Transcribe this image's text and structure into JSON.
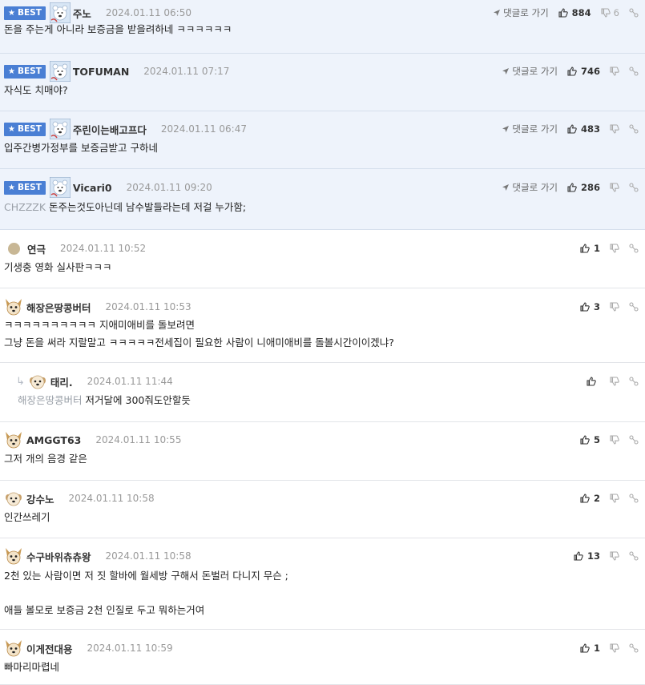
{
  "comments": [
    {
      "kind": "best",
      "badge": "BEST",
      "avatar": "polar-bear",
      "nick": "주노",
      "date": "2024.01.11 06:50",
      "reply_label": "댓글로 가기",
      "likes": "884",
      "dislikes": "6",
      "text": "돈을 주는게 아니라 보증금을 받을려하네 ㅋㅋㅋㅋㅋㅋ"
    },
    {
      "kind": "best",
      "badge": "BEST",
      "avatar": "polar-bear",
      "nick": "TOFUMAN",
      "date": "2024.01.11 07:17",
      "reply_label": "댓글로 가기",
      "likes": "746",
      "text": "자식도 치매야?"
    },
    {
      "kind": "best",
      "badge": "BEST",
      "avatar": "polar-bear",
      "nick": "주린이는배고프다",
      "date": "2024.01.11 06:47",
      "reply_label": "댓글로 가기",
      "likes": "483",
      "text": "입주간병가정부를 보증금받고 구하네"
    },
    {
      "kind": "best",
      "badge": "BEST",
      "avatar": "polar-bear",
      "nick": "Vicari0",
      "date": "2024.01.11 09:20",
      "reply_label": "댓글로 가기",
      "likes": "286",
      "mention": "CHZZZK",
      "text": "돈주는것도아닌데 남수발들라는데 저걸 누가함;"
    },
    {
      "kind": "normal",
      "avatar": "dot",
      "nick": "연극",
      "date": "2024.01.11 10:52",
      "likes": "1",
      "text": "기생충 영화 실사판ㅋㅋㅋ"
    },
    {
      "kind": "normal",
      "avatar": "dog",
      "nick": "해장은땅콩버터",
      "date": "2024.01.11 10:53",
      "likes": "3",
      "text": "ㅋㅋㅋㅋㅋㅋㅋㅋㅋㅋ 지애미애비를 돌보려면\n그냥 돈을 써라 지랄말고 ㅋㅋㅋㅋㅋ전세집이 필요한 사람이 니애미애비를 돌볼시간이이겠냐?"
    },
    {
      "kind": "reply",
      "avatar": "dog-light",
      "nick": "태리.",
      "date": "2024.01.11 11:44",
      "likes": "",
      "mention": "해장은땅콩버터",
      "text": "저거달에 300줘도안할듯"
    },
    {
      "kind": "normal",
      "avatar": "dog",
      "nick": "AMGGT63",
      "date": "2024.01.11 10:55",
      "likes": "5",
      "text": "그저 개의 음경 같은"
    },
    {
      "kind": "normal",
      "avatar": "dog-light",
      "nick": "강수노",
      "date": "2024.01.11 10:58",
      "likes": "2",
      "text": "인간쓰레기"
    },
    {
      "kind": "normal",
      "avatar": "dog",
      "nick": "수구바위츄츄왕",
      "date": "2024.01.11 10:58",
      "likes": "13",
      "text": "2천 있는 사람이면 저 짓 할바에 월세방 구해서 돈벌러 다니지 무슨 ;\n\n애들 볼모로 보증금 2천 인질로 두고 뭐하는거여"
    },
    {
      "kind": "normal",
      "avatar": "dog",
      "nick": "이게전대용",
      "date": "2024.01.11 10:59",
      "likes": "1",
      "text": "빠마리마렵네"
    }
  ],
  "colors": {
    "best_bg": "#eef3fb",
    "badge": "#4a7fd4",
    "mention": "#9aa0a8"
  }
}
